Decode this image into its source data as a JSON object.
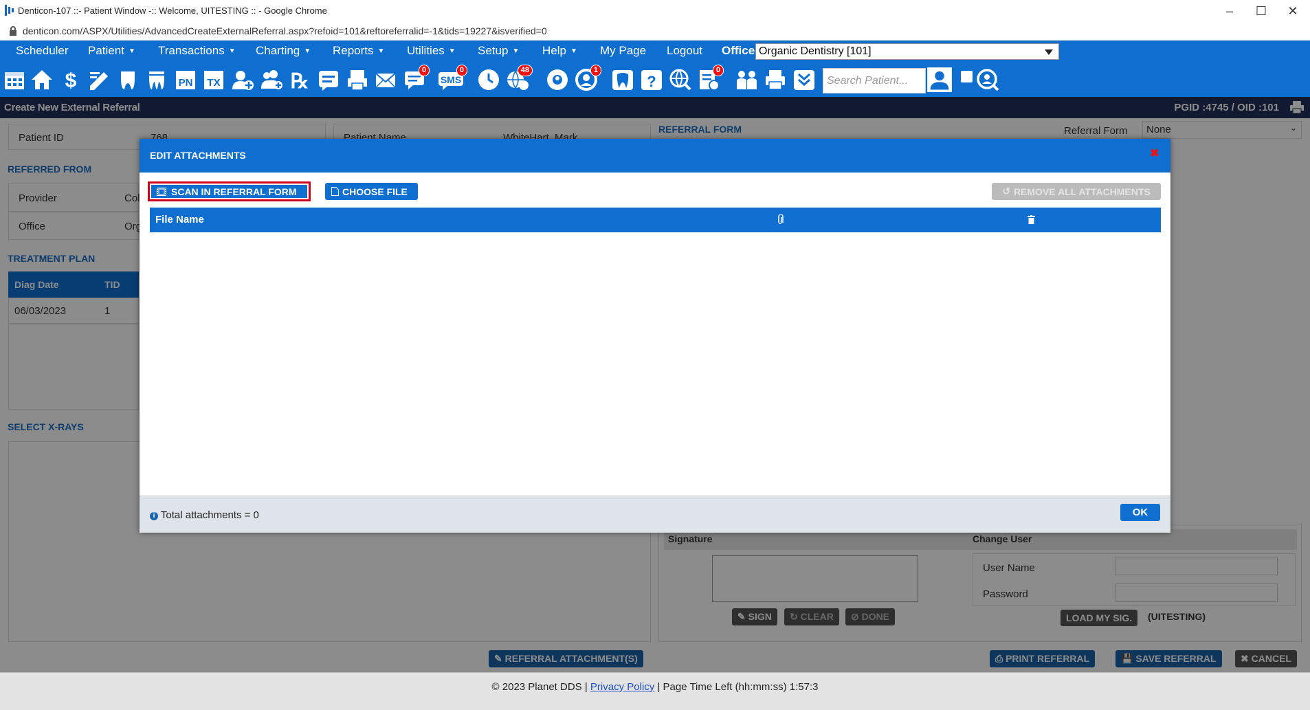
{
  "window": {
    "title": "Denticon-107 ::- Patient Window -:: Welcome, UITESTING :: - Google Chrome",
    "url": "denticon.com/ASPX/Utilities/AdvancedCreateExternalReferral.aspx?refoid=101&reftoreferralid=-1&tids=19227&isverified=0"
  },
  "menu": {
    "items": [
      "Scheduler",
      "Patient",
      "Transactions",
      "Charting",
      "Reports",
      "Utilities",
      "Setup",
      "Help",
      "My Page",
      "Logout"
    ],
    "office_label": "Office",
    "office_value": "Organic Dentistry [101]"
  },
  "toolbar": {
    "search_placeholder": "Search Patient...",
    "badges": {
      "messages": "0",
      "sms": "0",
      "web": "48",
      "alerts": "1",
      "forms": "0"
    },
    "pn": "PN",
    "tx": "TX",
    "sms_label": "SMS"
  },
  "page": {
    "title": "Create New External Referral",
    "ids": "PGID :4745  /  OID :101"
  },
  "background": {
    "patient_id_label": "Patient ID",
    "patient_id_value": "768",
    "patient_name_label": "Patient Name",
    "patient_name_value": "WhiteHart, Mark",
    "referral_form_section": "REFERRAL FORM",
    "referral_form_label": "Referral Form",
    "referral_form_value": "None",
    "referred_from": "REFERRED FROM",
    "provider_label": "Provider",
    "provider_value": "Col",
    "office_label": "Office",
    "office_value": "Org",
    "treatment_plan": "TREATMENT PLAN",
    "diag_date_header": "Diag Date",
    "tid_header": "TID",
    "diag_date": "06/03/2023",
    "tid": "1",
    "select_xrays": "SELECT X-RAYS",
    "signature_label": "Signature",
    "change_user_label": "Change User",
    "sign_btn": "SIGN",
    "clear_btn": "CLEAR",
    "done_btn": "DONE",
    "username_label": "User Name",
    "password_label": "Password",
    "load_sig_btn": "LOAD MY SIG.",
    "load_sig_user": "(UITESTING)",
    "referral_attachments_btn": "REFERRAL ATTACHMENT(S)",
    "print_btn": "PRINT REFERRAL",
    "save_btn": "SAVE REFERRAL",
    "cancel_btn": "CANCEL"
  },
  "modal": {
    "title": "EDIT ATTACHMENTS",
    "scan_btn": "SCAN IN REFERRAL FORM",
    "choose_btn": "CHOOSE FILE",
    "remove_btn": "REMOVE ALL ATTACHMENTS",
    "col_filename": "File Name",
    "total": "Total attachments = 0",
    "ok_btn": "OK"
  },
  "footer": {
    "copyright": "© 2023 Planet DDS |",
    "privacy": "Privacy Policy",
    "time": "|  Page Time Left (hh:mm:ss) 1:57:3"
  },
  "colors": {
    "brand_blue": "#0e6fd1",
    "header_navy": "#20305a",
    "highlight_red": "#d0021b"
  }
}
